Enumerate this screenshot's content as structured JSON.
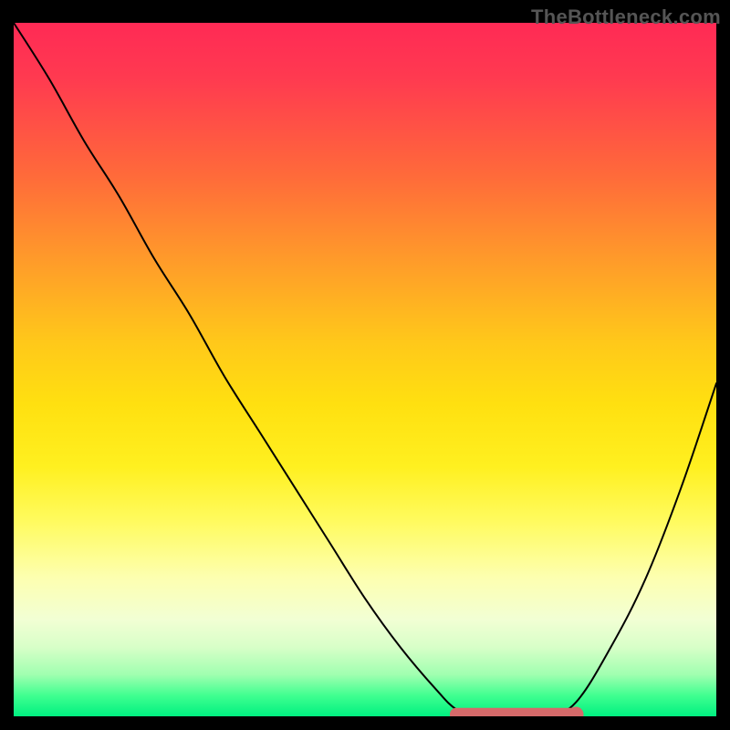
{
  "watermark": "TheBottleneck.com",
  "chart_data": {
    "type": "line",
    "title": "",
    "xlabel": "",
    "ylabel": "",
    "xlim": [
      0,
      100
    ],
    "ylim": [
      0,
      100
    ],
    "x": [
      0,
      5,
      10,
      15,
      20,
      25,
      30,
      35,
      40,
      45,
      50,
      55,
      60,
      63,
      66,
      70,
      73,
      76,
      80,
      85,
      90,
      95,
      100
    ],
    "values": [
      100,
      92,
      83,
      75,
      66,
      58,
      49,
      41,
      33,
      25,
      17,
      10,
      4,
      1,
      0,
      0,
      0,
      0,
      2,
      10,
      20,
      33,
      48
    ],
    "flat_zone": {
      "x_start": 63,
      "x_end": 80,
      "color": "#d56a6a",
      "thickness": 4.5,
      "endpoint": "dot"
    },
    "gradient_stops": [
      {
        "pos": 0,
        "color": "#ff2a55"
      },
      {
        "pos": 22,
        "color": "#ff6a3a"
      },
      {
        "pos": 46,
        "color": "#ffc81a"
      },
      {
        "pos": 72,
        "color": "#fffb60"
      },
      {
        "pos": 90,
        "color": "#d8ffc8"
      },
      {
        "pos": 100,
        "color": "#00f080"
      }
    ]
  }
}
